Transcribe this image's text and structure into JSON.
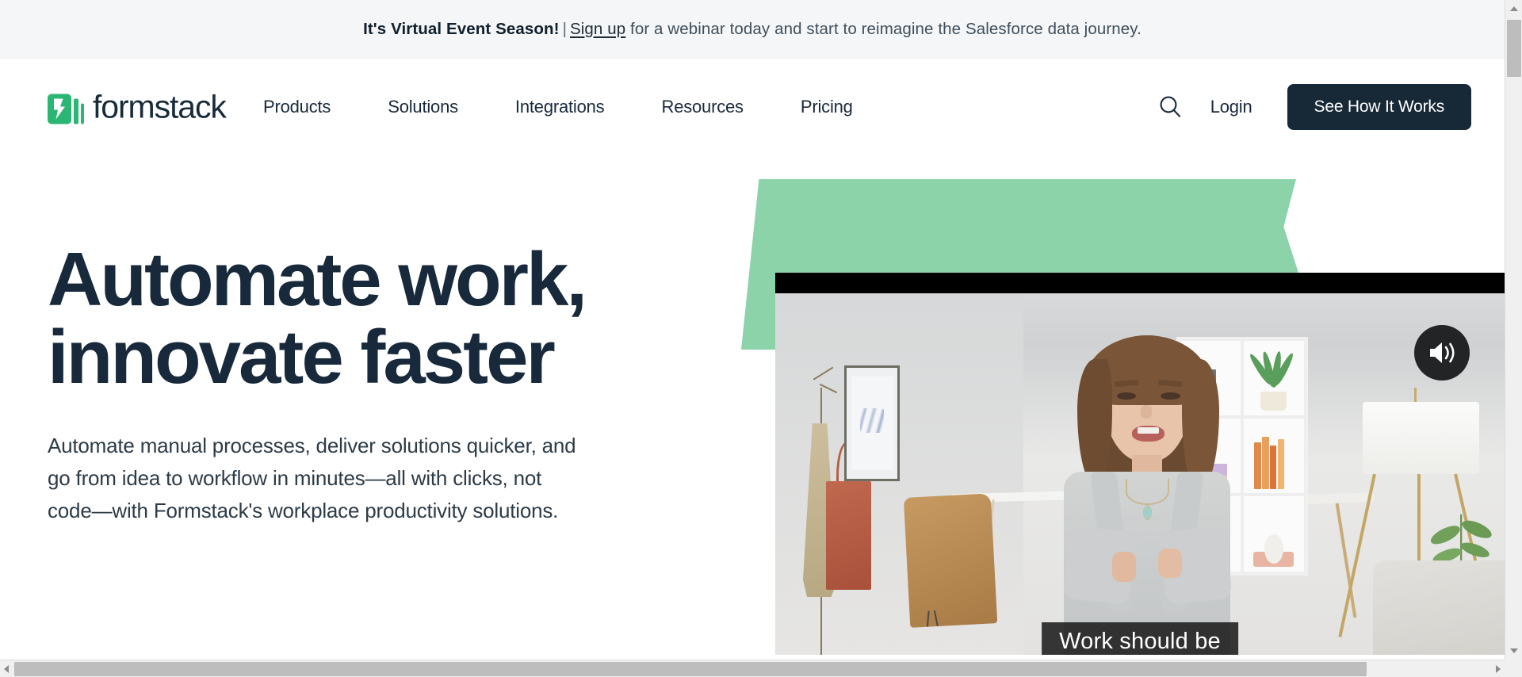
{
  "banner": {
    "strong": "It's Virtual Event Season!",
    "divider": "|",
    "link": "Sign up",
    "rest": " for a webinar today and start to reimagine the Salesforce data journey."
  },
  "nav": {
    "logo_text": "formstack",
    "logo_icon": "formstack-bolt-icon",
    "links": [
      {
        "label": "Products"
      },
      {
        "label": "Solutions"
      },
      {
        "label": "Integrations"
      },
      {
        "label": "Resources"
      },
      {
        "label": "Pricing"
      }
    ],
    "search_icon": "search-icon",
    "login_label": "Login",
    "cta_label": "See How It Works"
  },
  "hero": {
    "title_line1": "Automate work,",
    "title_line2": "innovate faster",
    "subtitle": "Automate manual processes, deliver solutions quicker, and go from idea to workflow in minutes—all with clicks, not code—with Formstack's workplace productivity solutions.",
    "video": {
      "volume_icon": "volume-on-icon",
      "caption": "Work should be"
    }
  },
  "colors": {
    "brand_green": "#2bb673",
    "accent_mint": "#8cd3a9",
    "ink_navy": "#17293a",
    "banner_bg": "#f4f6f8",
    "cta_bg": "#172836"
  },
  "scrollbars": {
    "vertical": {
      "up_icon": "triangle-up-icon",
      "down_icon": "triangle-down-icon"
    },
    "horizontal": {
      "left_icon": "triangle-left-icon",
      "right_icon": "triangle-right-icon"
    }
  }
}
